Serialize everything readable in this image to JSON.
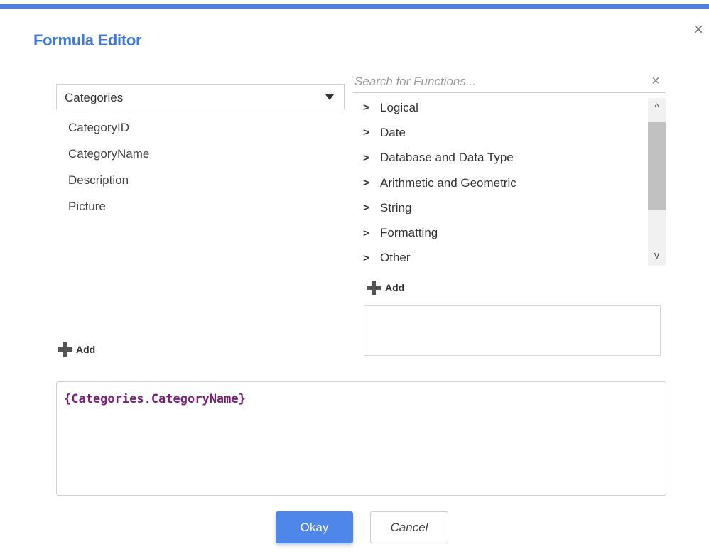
{
  "dialog": {
    "title": "Formula Editor",
    "accent_color": "#4f7fe6",
    "close_icon": "close-icon"
  },
  "fields_panel": {
    "selected_table": "Categories",
    "fields": [
      "CategoryID",
      "CategoryName",
      "Description",
      "Picture"
    ],
    "add_label": "Add"
  },
  "functions_panel": {
    "search_placeholder": "Search for Functions...",
    "categories": [
      "Logical",
      "Date",
      "Database and Data Type",
      "Arithmetic and Geometric",
      "String",
      "Formatting",
      "Other"
    ],
    "add_label": "Add"
  },
  "formula": {
    "text": "{Categories.CategoryName}",
    "color": "#7a1e7a"
  },
  "footer": {
    "okay_label": "Okay",
    "cancel_label": "Cancel"
  }
}
